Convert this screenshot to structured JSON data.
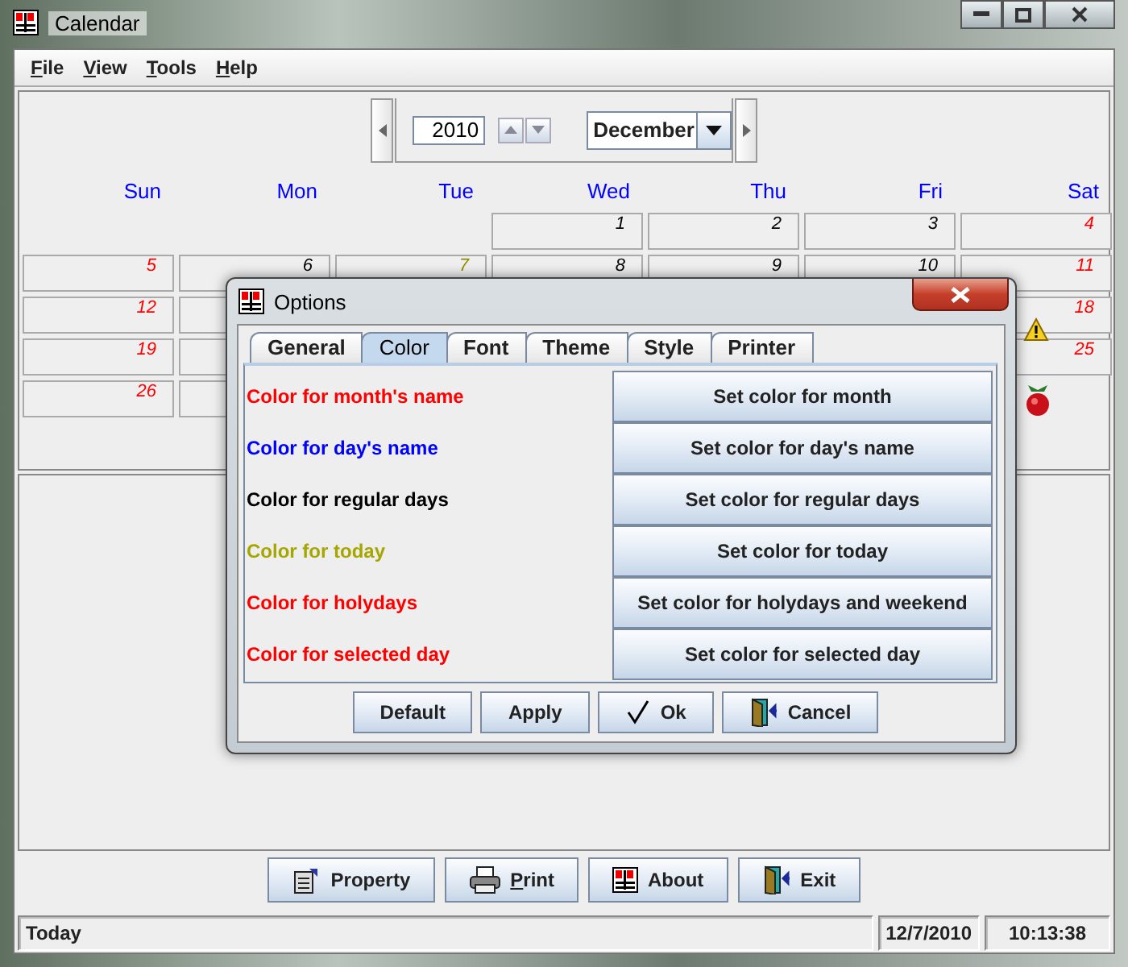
{
  "window": {
    "title": "Calendar"
  },
  "menu": [
    {
      "label": "File",
      "mnemonic": true
    },
    {
      "label": "View",
      "mnemonic": true
    },
    {
      "label": "Tools",
      "mnemonic": true
    },
    {
      "label": "Help",
      "mnemonic": true
    }
  ],
  "navigator": {
    "year": "2010",
    "month": "December"
  },
  "day_names": [
    "Sun",
    "Mon",
    "Tue",
    "Wed",
    "Thu",
    "Fri",
    "Sat"
  ],
  "weeks": [
    [
      {
        "kind": "blank"
      },
      {
        "kind": "blank"
      },
      {
        "kind": "blank"
      },
      {
        "kind": "regular",
        "day": "1"
      },
      {
        "kind": "regular",
        "day": "2"
      },
      {
        "kind": "regular",
        "day": "3"
      },
      {
        "kind": "holiday",
        "day": "4"
      }
    ],
    [
      {
        "kind": "holiday",
        "day": "5"
      },
      {
        "kind": "regular",
        "day": "6"
      },
      {
        "kind": "today",
        "day": "7"
      },
      {
        "kind": "regular",
        "day": "8"
      },
      {
        "kind": "regular",
        "day": "9"
      },
      {
        "kind": "regular",
        "day": "10"
      },
      {
        "kind": "holiday",
        "day": "11"
      }
    ],
    [
      {
        "kind": "holiday",
        "day": "12"
      },
      {
        "kind": "covered"
      },
      {
        "kind": "hidden"
      },
      {
        "kind": "hidden"
      },
      {
        "kind": "hidden"
      },
      {
        "kind": "hidden"
      },
      {
        "kind": "holiday",
        "day": "18"
      }
    ],
    [
      {
        "kind": "holiday",
        "day": "19"
      },
      {
        "kind": "covered"
      },
      {
        "kind": "hidden"
      },
      {
        "kind": "hidden"
      },
      {
        "kind": "hidden"
      },
      {
        "kind": "hidden"
      },
      {
        "kind": "holiday",
        "day": "25"
      }
    ],
    [
      {
        "kind": "holiday",
        "day": "26"
      },
      {
        "kind": "covered"
      },
      {
        "kind": "hidden"
      },
      {
        "kind": "hidden"
      },
      {
        "kind": "hidden"
      },
      {
        "kind": "hidden"
      },
      {
        "kind": "blank"
      }
    ]
  ],
  "buttons": [
    {
      "label": "Property",
      "kind": "property"
    },
    {
      "label": "Print",
      "kind": "print",
      "mnemonic": true
    },
    {
      "label": "About",
      "kind": "about"
    },
    {
      "label": "Exit",
      "kind": "exit"
    }
  ],
  "status_bar": {
    "message": "Today",
    "date": "12/7/2010",
    "time": "10:13:38"
  },
  "dialog": {
    "title": "Options",
    "tabs": [
      {
        "label": "General",
        "selected": false
      },
      {
        "label": "Color",
        "selected": true
      },
      {
        "label": "Font",
        "selected": false
      },
      {
        "label": "Theme",
        "selected": false
      },
      {
        "label": "Style",
        "selected": false
      },
      {
        "label": "Printer",
        "selected": false
      }
    ],
    "rows": [
      {
        "label": "Color for month's name",
        "color": "#ff0000",
        "button": "Set color for month"
      },
      {
        "label": "Color for day's name",
        "color": "#0000ff",
        "button": "Set color for day's name"
      },
      {
        "label": "Color for regular days",
        "color": "#000000",
        "button": "Set color for regular days"
      },
      {
        "label": "Color for today",
        "color": "#a6a600",
        "button": "Set color for today"
      },
      {
        "label": "Color for holydays",
        "color": "#ff0000",
        "button": "Set color for holydays and weekend"
      },
      {
        "label": "Color for selected day",
        "color": "#ff0000",
        "button": "Set color for selected day"
      }
    ],
    "buttons": [
      {
        "label": "Default",
        "kind": "plain"
      },
      {
        "label": "Apply",
        "kind": "plain"
      },
      {
        "label": "Ok",
        "kind": "ok"
      },
      {
        "label": "Cancel",
        "kind": "cancel"
      }
    ]
  }
}
